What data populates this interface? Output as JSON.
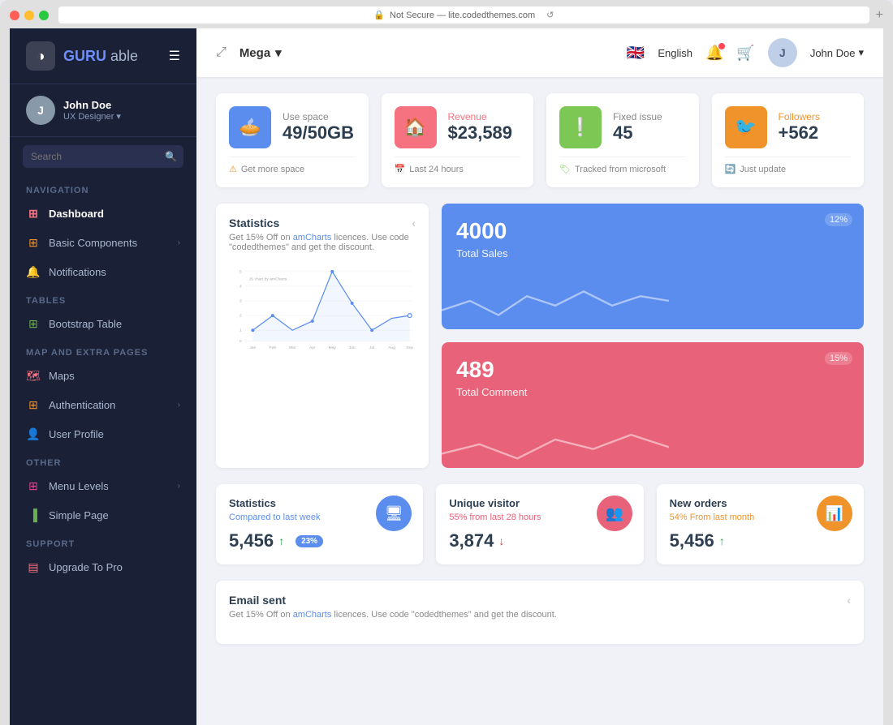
{
  "browser": {
    "address": "Not Secure — lite.codedthemes.com",
    "reload_label": "↺"
  },
  "sidebar": {
    "logo_text": "GURU",
    "logo_span": "able",
    "user": {
      "name": "John Doe",
      "role": "UX Designer"
    },
    "search_placeholder": "Search",
    "sections": [
      {
        "label": "Navigation",
        "items": [
          {
            "id": "dashboard",
            "label": "Dashboard",
            "icon": "⊞",
            "icon_class": "red",
            "active": true
          },
          {
            "id": "basic-components",
            "label": "Basic Components",
            "icon": "⊞",
            "icon_class": "orange",
            "has_chevron": true
          },
          {
            "id": "notifications",
            "label": "Notifications",
            "icon": "🔔",
            "icon_class": "blue"
          }
        ]
      },
      {
        "label": "Tables",
        "items": [
          {
            "id": "bootstrap-table",
            "label": "Bootstrap Table",
            "icon": "⊞",
            "icon_class": "green"
          }
        ]
      },
      {
        "label": "Map And Extra Pages",
        "items": [
          {
            "id": "maps",
            "label": "Maps",
            "icon": "🗺",
            "icon_class": "red"
          },
          {
            "id": "authentication",
            "label": "Authentication",
            "icon": "⊞",
            "icon_class": "orange",
            "has_chevron": true
          },
          {
            "id": "user-profile",
            "label": "User Profile",
            "icon": "👤",
            "icon_class": "blue"
          }
        ]
      },
      {
        "label": "Other",
        "items": [
          {
            "id": "menu-levels",
            "label": "Menu Levels",
            "icon": "⊞",
            "icon_class": "pink",
            "has_chevron": true
          },
          {
            "id": "simple-page",
            "label": "Simple Page",
            "icon": "▐",
            "icon_class": "green"
          }
        ]
      },
      {
        "label": "Support",
        "items": [
          {
            "id": "upgrade-pro",
            "label": "Upgrade To Pro",
            "icon": "▤",
            "icon_class": "red"
          }
        ]
      }
    ]
  },
  "header": {
    "mega_label": "Mega",
    "language": "English",
    "user_name": "John Doe"
  },
  "stat_cards": [
    {
      "id": "use-space",
      "label": "Use space",
      "label_class": "",
      "value": "49/50GB",
      "icon": "🥧",
      "icon_class": "blue-bg",
      "footer": "Get more space",
      "footer_icon": "⚠"
    },
    {
      "id": "revenue",
      "label": "Revenue",
      "label_class": "red",
      "value": "$23,589",
      "icon": "🏠",
      "icon_class": "red-bg",
      "footer": "Last 24 hours",
      "footer_icon": "📅"
    },
    {
      "id": "fixed-issue",
      "label": "Fixed issue",
      "label_class": "",
      "value": "45",
      "icon": "❕",
      "icon_class": "green-bg",
      "footer": "Tracked from microsoft",
      "footer_icon": "🏷"
    },
    {
      "id": "followers",
      "label": "Followers",
      "label_class": "orange",
      "value": "+562",
      "icon": "🐦",
      "icon_class": "orange-bg",
      "footer": "Just update",
      "footer_icon": "🔄"
    }
  ],
  "statistics_chart": {
    "title": "Statistics",
    "subtitle_text": "Get 15% Off on ",
    "subtitle_link": "amCharts",
    "subtitle_rest": " licences. Use code \"codedthemes\" and get the discount.",
    "x_labels": [
      "Jan",
      "Feb",
      "Mar",
      "Apr",
      "May",
      "Jun",
      "Jul",
      "Aug",
      "Sep"
    ],
    "y_labels": [
      "0",
      "1",
      "2",
      "3",
      "4",
      "5"
    ]
  },
  "right_panels": [
    {
      "id": "total-sales",
      "number": "4000",
      "label": "Total Sales",
      "pct": "12%",
      "color_class": "blue-panel"
    },
    {
      "id": "total-comment",
      "number": "489",
      "label": "Total Comment",
      "pct": "15%",
      "color_class": "red-panel"
    }
  ],
  "mini_cards": [
    {
      "id": "statistics-mini",
      "title": "Statistics",
      "subtitle": "Compared to last week",
      "subtitle_class": "blue",
      "value": "5,456",
      "trend": "up",
      "badge": "23%",
      "icon": "🖥",
      "icon_class": "blue-ic"
    },
    {
      "id": "unique-visitor",
      "title": "Unique visitor",
      "subtitle": "55% from last 28 hours",
      "subtitle_class": "red",
      "value": "3,874",
      "trend": "down",
      "badge": null,
      "icon": "👥",
      "icon_class": "pink-ic"
    },
    {
      "id": "new-orders",
      "title": "New orders",
      "subtitle": "54% From last month",
      "subtitle_class": "orange",
      "value": "5,456",
      "trend": "up",
      "badge": null,
      "icon": "📊",
      "icon_class": "orange-ic"
    }
  ],
  "email_card": {
    "title": "Email sent",
    "subtitle_text": "Get 15% Off on ",
    "subtitle_link": "amCharts",
    "subtitle_rest": " licences. Use code \"codedthemes\" and get the discount."
  },
  "colors": {
    "sidebar_bg": "#1a2035",
    "accent_blue": "#5b8dee",
    "accent_red": "#f67280",
    "accent_green": "#7dc855",
    "accent_orange": "#f0932b"
  }
}
